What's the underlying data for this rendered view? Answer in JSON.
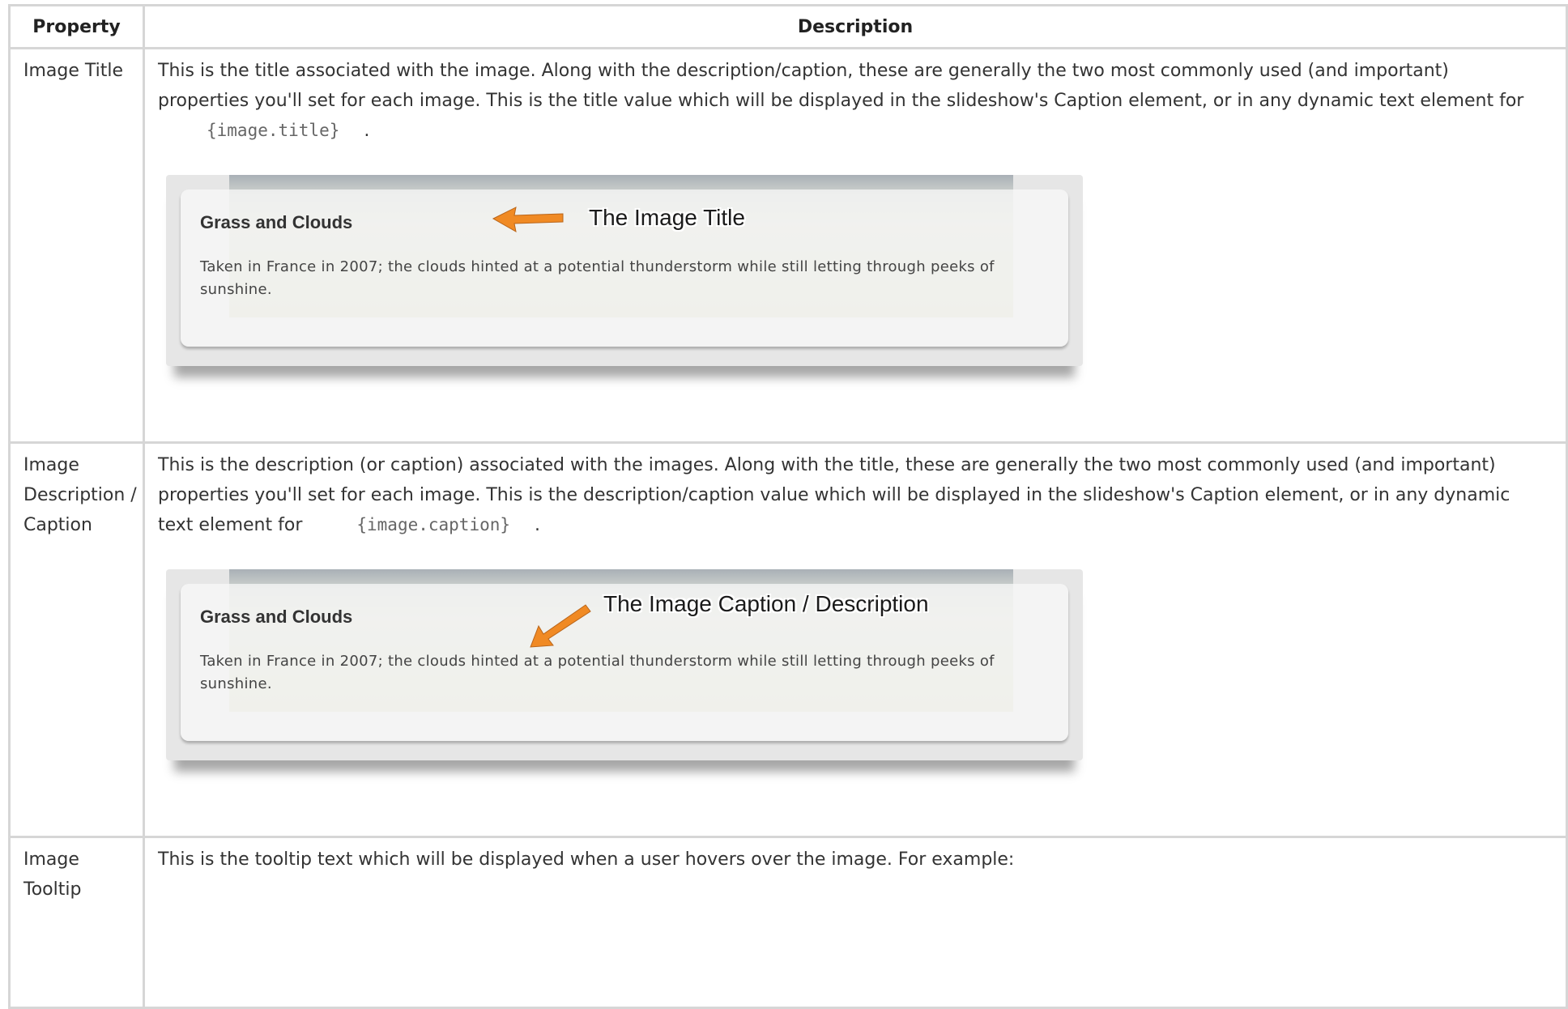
{
  "table": {
    "headers": {
      "property": "Property",
      "description": "Description"
    },
    "rows": [
      {
        "property": "Image Title",
        "desc_pre": "This is the title associated with the image.    Along with the description/caption, these are generally the two most commonly used (and important) properties you'll set for each image.    This is the title value which will be displayed in the slideshow's Caption element, or in any dynamic text element for",
        "code": "{image.title}",
        "desc_post": ".",
        "mock": {
          "title": "Grass and Clouds",
          "caption": "Taken in France in 2007; the clouds hinted at a potential thunderstorm while still letting through peeks of sunshine.",
          "callout": "The Image Title"
        }
      },
      {
        "property": "Image Description / Caption",
        "desc_pre": "This is the description (or caption) associated with the images.  Along with the title, these are generally the two most commonly used (and important) properties you'll set for each image.    This is the description/caption value which will be displayed in the slideshow's Caption element, or in any dynamic text element for",
        "code": "{image.caption}",
        "desc_post": ".",
        "mock": {
          "title": "Grass and Clouds",
          "caption": "Taken in France in 2007; the clouds hinted at a potential thunderstorm while still letting through peeks of sunshine.",
          "callout": "The Image Caption / Description"
        }
      },
      {
        "property": "Image Tooltip",
        "desc_pre": "This is the tooltip text which will be displayed when a user hovers over the image.  For example:"
      }
    ]
  },
  "colors": {
    "arrow": "#f08a24",
    "border": "#d6d6d6"
  }
}
